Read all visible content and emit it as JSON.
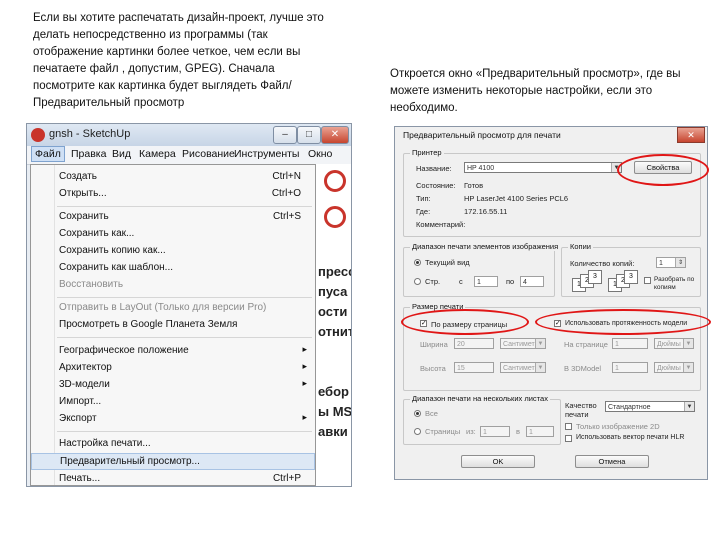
{
  "captions": {
    "left": "Если вы хотите распечатать дизайн-проект, лучше это делать непосредственно из программы (так отображение картинки более четкое, чем если вы печатаете файл , допустим, GPEG). Сначала посмотрите как картинка будет выглядеть Файл/Предварительный просмотр",
    "right": "Откроется окно «Предварительный просмотр», где вы можете изменить некоторые настройки, если это необходимо."
  },
  "sketchup": {
    "title": "gnsh - SketchUp",
    "window_buttons": [
      "–",
      "□",
      "✕"
    ],
    "menubar": [
      "Файл",
      "Правка",
      "Вид",
      "Камера",
      "Рисование",
      "Инструменты",
      "Окно"
    ],
    "canvas_text": [
      "пресс",
      "пуса",
      "ости 2",
      "отнит",
      "ебор",
      "ы MS",
      "авки"
    ],
    "file_menu": [
      {
        "label": "Создать",
        "shortcut": "Ctrl+N"
      },
      {
        "label": "Открыть...",
        "shortcut": "Ctrl+O"
      },
      {
        "label": "Сохранить",
        "shortcut": "Ctrl+S"
      },
      {
        "label": "Сохранить как...",
        "shortcut": ""
      },
      {
        "label": "Сохранить копию как...",
        "shortcut": ""
      },
      {
        "label": "Сохранить как шаблон...",
        "shortcut": ""
      },
      {
        "label": "Восстановить",
        "shortcut": ""
      },
      {
        "label": "Отправить в LayOut (Только для версии Pro)",
        "shortcut": ""
      },
      {
        "label": "Просмотреть в Google Планета Земля",
        "shortcut": ""
      },
      {
        "label": "Географическое положение",
        "shortcut": ""
      },
      {
        "label": "Архитектор",
        "shortcut": ""
      },
      {
        "label": "3D-модели",
        "shortcut": ""
      },
      {
        "label": "Импорт...",
        "shortcut": ""
      },
      {
        "label": "Экспорт",
        "shortcut": ""
      },
      {
        "label": "Настройка печати...",
        "shortcut": ""
      },
      {
        "label": "Предварительный просмотр...",
        "shortcut": ""
      },
      {
        "label": "Печать...",
        "shortcut": "Ctrl+P"
      }
    ],
    "submenu_arrow": "▸"
  },
  "preview_dialog": {
    "title": "Предварительный просмотр для печати",
    "close": "✕",
    "printer": {
      "group": "Принтер",
      "name_label": "Название:",
      "name_value": "HP 4100",
      "properties_button": "Свойства",
      "status_label": "Состояние:",
      "status_value": "Готов",
      "type_label": "Тип:",
      "type_value": "HP LaserJet 4100 Series PCL6",
      "where_label": "Где:",
      "where_value": "172.16.55.11",
      "comment_label": "Комментарий:"
    },
    "tile_range": {
      "group": "Диапазон печати элементов изображения",
      "current_view": "Текущий вид",
      "pages": "Стр.",
      "from_label": "с",
      "from_value": "1",
      "to_label": "по",
      "to_value": "4"
    },
    "copies": {
      "group": "Копии",
      "count_label": "Количество копий:",
      "count_value": "1",
      "collate": "Разобрать по копиям",
      "page_numbers": [
        "1",
        "2",
        "3"
      ]
    },
    "print_size": {
      "group": "Размер печати",
      "fit_to_page": "По размеру страницы",
      "use_model_extents": "Использовать протяженность модели",
      "width_label": "Ширина",
      "width_value": "20",
      "width_unit": "Сантиметры",
      "height_label": "Высота",
      "height_value": "15",
      "height_unit": "Сантиметры",
      "on_page_label": "На странице",
      "on_page_value": "1",
      "on_page_unit": "Дюймы",
      "scale_label": "В 3DModel",
      "scale_value": "1",
      "scale_unit": "Дюймы"
    },
    "multi_page": {
      "group": "Диапазон печати на нескольких листах",
      "all": "Все",
      "pages": "Страницы",
      "from_label": "из:",
      "from_value": "1",
      "to_label": "в",
      "to_value": "1"
    },
    "quality": {
      "label": "Качество печати",
      "value": "Стандартное",
      "two_d": "Только изображение 2D",
      "hlr": "Использовать вектор печати HLR"
    },
    "ok_button": "OK",
    "cancel_button": "Отмена"
  },
  "colors": {
    "highlight_ring": "#e01616",
    "menu_highlight": "#dde8f5",
    "sketchup_red": "#c9342b"
  }
}
